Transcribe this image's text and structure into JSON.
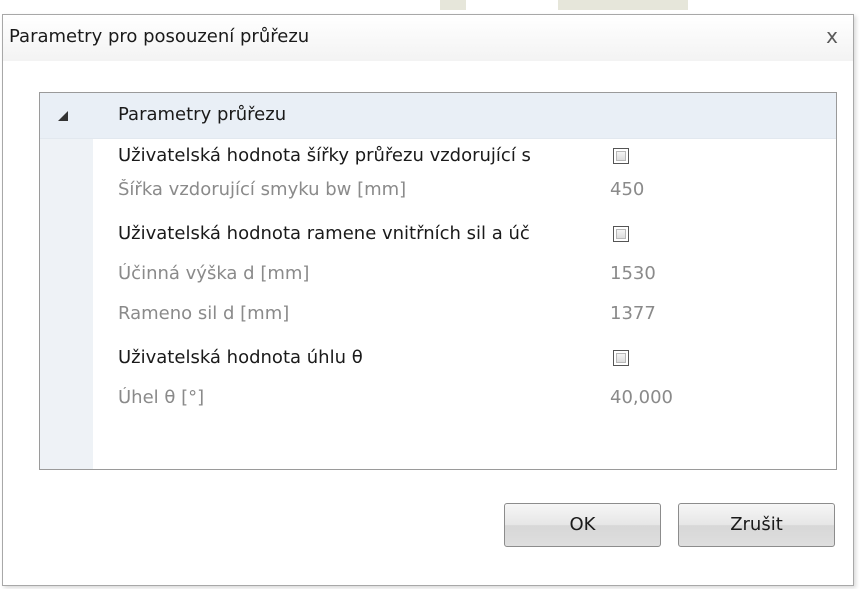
{
  "dialog": {
    "title": "Parametry pro posouzení průřezu",
    "close_glyph": "x"
  },
  "grid": {
    "category": {
      "label": "Parametry průřezu",
      "expanded": true
    },
    "rows": [
      {
        "label": "Uživatelská hodnota šířky průřezu vzdorující s",
        "type": "checkbox",
        "checked": false,
        "disabled": false
      },
      {
        "label": "Šířka vzdorující smyku bw [mm]",
        "type": "value",
        "value": "450",
        "disabled": true
      },
      {
        "label": "Uživatelská hodnota ramene vnitřních sil a úč",
        "type": "checkbox",
        "checked": false,
        "disabled": false
      },
      {
        "label": "Účinná výška d [mm]",
        "type": "value",
        "value": "1530",
        "disabled": true
      },
      {
        "label": "Rameno sil d [mm]",
        "type": "value",
        "value": "1377",
        "disabled": true
      },
      {
        "label": "Uživatelská hodnota úhlu θ",
        "type": "checkbox",
        "checked": false,
        "disabled": false
      },
      {
        "label": "Úhel θ [°]",
        "type": "value",
        "value": "40,000",
        "disabled": true
      }
    ]
  },
  "buttons": {
    "ok_label": "OK",
    "cancel_label": "Zrušit"
  }
}
